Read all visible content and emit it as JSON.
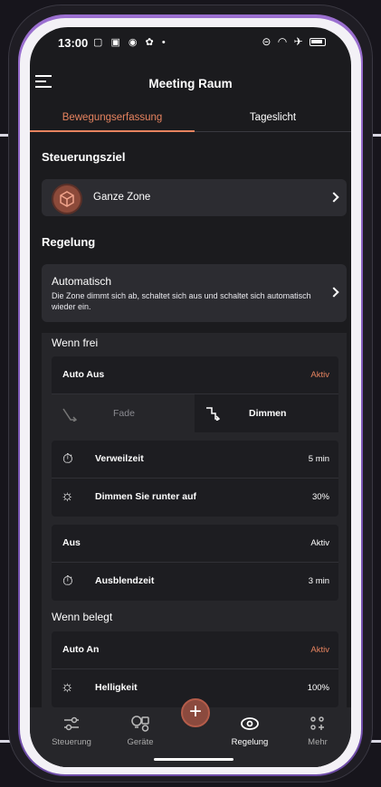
{
  "status_bar": {
    "time": "13:00",
    "left_icons": "▢ ▣ ◉ ✿ •",
    "right_icons": "⊝ ◠ ✈"
  },
  "header": {
    "title": "Meeting Raum",
    "menu_icon": "hamburger-icon"
  },
  "tabs": [
    {
      "label": "Bewegungserfassung",
      "active": true
    },
    {
      "label": "Tageslicht",
      "active": false
    }
  ],
  "steuerungsziel": {
    "heading": "Steuerungsziel",
    "zone_label": "Ganze Zone",
    "zone_icon": "cube-icon"
  },
  "regelung": {
    "heading": "Regelung",
    "mode_title": "Automatisch",
    "mode_description": "Die Zone dimmt sich ab, schaltet sich aus und schaltet sich automatisch wieder ein."
  },
  "wenn_frei": {
    "heading": "Wenn frei",
    "auto_aus": {
      "label": "Auto Aus",
      "status": "Aktiv"
    },
    "toggle": {
      "fade": "Fade",
      "dimmen": "Dimmen",
      "selected": "Dimmen"
    },
    "verweilzeit": {
      "label": "Verweilzeit",
      "value": "5 min"
    },
    "dimmen_runter": {
      "label": "Dimmen Sie runter auf",
      "value": "30%"
    },
    "aus": {
      "label": "Aus",
      "status": "Aktiv"
    },
    "ausblendzeit": {
      "label": "Ausblendzeit",
      "value": "3 min"
    }
  },
  "wenn_belegt": {
    "heading": "Wenn belegt",
    "auto_an": {
      "label": "Auto An",
      "status": "Aktiv"
    },
    "helligkeit": {
      "label": "Helligkeit",
      "value": "100%"
    }
  },
  "bottom_nav": {
    "items": [
      {
        "label": "Steuerung",
        "icon": "sliders-icon"
      },
      {
        "label": "Geräte",
        "icon": "devices-icon"
      },
      {
        "label": "Regelung",
        "icon": "eye-icon",
        "active": true
      },
      {
        "label": "Mehr",
        "icon": "more-grid-icon"
      }
    ],
    "add_icon": "plus-icon",
    "add_symbol": "+"
  },
  "colors": {
    "accent": "#e6835f",
    "background": "#1b1b1e",
    "card": "#2c2c31"
  }
}
